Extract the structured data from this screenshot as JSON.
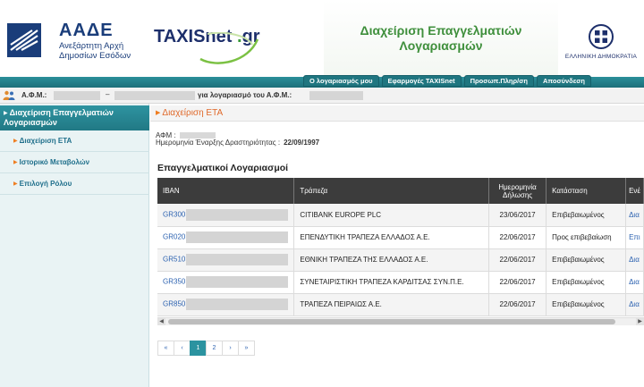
{
  "header": {
    "aade_title": "ΑΑΔΕ",
    "aade_sub1": "Ανεξάρτητη Αρχή",
    "aade_sub2": "Δημοσίων Εσόδων",
    "taxisnet": "TAXISnet",
    "taxisnet_suffix": "gr",
    "app_title_line1": "Διαχείριση Επαγγελματιών",
    "app_title_line2": "Λογαριασμών",
    "gov_label": "ΕΛΛΗΝΙΚΗ ΔΗΜΟΚΡΑΤΙΑ"
  },
  "nav": {
    "tabs": [
      "Ο λογαριασμός μου",
      "Εφαρμογές TAXISnet",
      "Προσωπ.Πληρ/ση",
      "Αποσύνδεση"
    ]
  },
  "user_bar": {
    "afm_label": "Α.Φ.Μ.:",
    "dash": "–",
    "for_account_text": "για λογαριασμό του Α.Φ.Μ.:"
  },
  "sidebar": {
    "active_label": "Διαχείριση Επαγγελματιών Λογαριασμών",
    "items": [
      {
        "label": "Διαχείριση ΕΤΑ"
      },
      {
        "label": "Ιστορικό Μεταβολών"
      },
      {
        "label": "Επιλογή Ρόλου"
      }
    ]
  },
  "main": {
    "breadcrumb": "Διαχείριση ΕΤΑ",
    "afm_label": "ΑΦΜ :",
    "start_date_label": "Ημερομηνία Έναρξης Δραστηριότητας :",
    "start_date_value": "22/09/1997",
    "section_title": "Επαγγελματικοί Λογαριασμοί",
    "columns": {
      "iban": "IBAN",
      "bank": "Τράπεζα",
      "date_line1": "Ημερομηνία",
      "date_line2": "Δήλωσης",
      "status": "Κατάσταση",
      "action": "Ενέ"
    },
    "rows": [
      {
        "iban_prefix": "GR300",
        "bank": "CITIBANK EUROPE PLC",
        "date": "23/06/2017",
        "status": "Επιβεβαιωμένος",
        "action": "Δια"
      },
      {
        "iban_prefix": "GR020",
        "bank": "ΕΠΕΝΔΥΤΙΚΗ ΤΡΑΠΕΖΑ ΕΛΛΑΔΟΣ Α.Ε.",
        "date": "22/06/2017",
        "status": "Προς επιβεβαίωση",
        "action": "Επι"
      },
      {
        "iban_prefix": "GR510",
        "bank": "ΕΘΝΙΚΗ ΤΡΑΠΕΖΑ ΤΗΣ ΕΛΛΑΔΟΣ Α.Ε.",
        "date": "22/06/2017",
        "status": "Επιβεβαιωμένος",
        "action": "Δια"
      },
      {
        "iban_prefix": "GR350",
        "bank": "ΣΥΝΕΤΑΙΡΙΣΤΙΚΗ ΤΡΑΠΕΖΑ ΚΑΡΔΙΤΣΑΣ ΣΥΝ.Π.Ε.",
        "date": "22/06/2017",
        "status": "Επιβεβαιωμένος",
        "action": "Δια"
      },
      {
        "iban_prefix": "GR850",
        "bank": "ΤΡΑΠΕΖΑ ΠΕΙΡΑΙΩΣ Α.Ε.",
        "date": "22/06/2017",
        "status": "Επιβεβαιωμένος",
        "action": "Δια"
      }
    ],
    "pagination": {
      "first": "«",
      "prev": "‹",
      "pages": [
        "1",
        "2"
      ],
      "active_page": "1",
      "next": "›",
      "last": "»"
    }
  },
  "colors": {
    "nav_teal": "#1f7680",
    "header_green": "#3f8f3c",
    "link_blue": "#2c62b0",
    "breadcrumb_orange": "#e0692a",
    "table_header": "#3c3c3c"
  }
}
